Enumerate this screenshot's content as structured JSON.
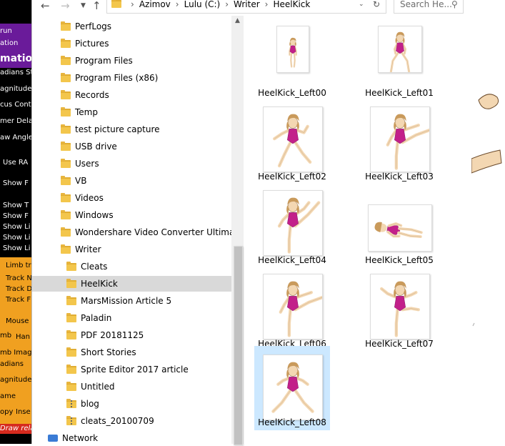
{
  "background_app": {
    "labels": [
      "run",
      "ation",
      "mation",
      "adians Ste",
      "agnitude",
      "cus Cont",
      "mer Delay",
      "aw Angle",
      "Use RA",
      "Show F",
      "Show T",
      "Show F",
      "Show Li",
      "Show Li",
      "Show Li",
      "Limb tra",
      "Track N",
      "Track D",
      "Track F",
      "Mouse",
      "mb",
      "Han",
      "mb Image",
      "adians",
      "agnitude",
      "ame",
      "opy",
      "Inse",
      "Draw relat"
    ]
  },
  "address_bar": {
    "back_icon": "arrow-left-icon",
    "forward_icon": "arrow-right-icon",
    "recent_icon": "chevron-down-icon",
    "up_icon": "arrow-up-icon",
    "breadcrumbs": [
      "Azimov",
      "Lulu (C:)",
      "Writer",
      "HeelKick"
    ],
    "search_placeholder": "Search He..."
  },
  "nav_pane": {
    "items": [
      {
        "label": "PerfLogs",
        "indent": 1,
        "icon": "folder-icon"
      },
      {
        "label": "Pictures",
        "indent": 1,
        "icon": "folder-icon"
      },
      {
        "label": "Program Files",
        "indent": 1,
        "icon": "folder-icon"
      },
      {
        "label": "Program Files (x86)",
        "indent": 1,
        "icon": "folder-icon"
      },
      {
        "label": "Records",
        "indent": 1,
        "icon": "folder-icon"
      },
      {
        "label": "Temp",
        "indent": 1,
        "icon": "folder-icon"
      },
      {
        "label": "test picture capture",
        "indent": 1,
        "icon": "folder-icon"
      },
      {
        "label": "USB drive",
        "indent": 1,
        "icon": "folder-icon"
      },
      {
        "label": "Users",
        "indent": 1,
        "icon": "folder-icon"
      },
      {
        "label": "VB",
        "indent": 1,
        "icon": "folder-icon"
      },
      {
        "label": "Videos",
        "indent": 1,
        "icon": "folder-icon"
      },
      {
        "label": "Windows",
        "indent": 1,
        "icon": "folder-icon"
      },
      {
        "label": "Wondershare Video Converter Ultimate",
        "indent": 1,
        "icon": "folder-icon"
      },
      {
        "label": "Writer",
        "indent": 1,
        "icon": "folder-icon"
      },
      {
        "label": "Cleats",
        "indent": 2,
        "icon": "folder-icon"
      },
      {
        "label": "HeelKick",
        "indent": 2,
        "icon": "folder-icon",
        "selected": true
      },
      {
        "label": "MarsMission Article 5",
        "indent": 2,
        "icon": "folder-icon"
      },
      {
        "label": "Paladin",
        "indent": 2,
        "icon": "folder-icon"
      },
      {
        "label": "PDF 20181125",
        "indent": 2,
        "icon": "folder-icon"
      },
      {
        "label": "Short Stories",
        "indent": 2,
        "icon": "folder-icon"
      },
      {
        "label": "Sprite Editor 2017 article",
        "indent": 2,
        "icon": "folder-icon"
      },
      {
        "label": "Untitled",
        "indent": 2,
        "icon": "folder-icon"
      },
      {
        "label": "blog",
        "indent": 2,
        "icon": "zip-folder-icon"
      },
      {
        "label": "cleats_20100709",
        "indent": 2,
        "icon": "zip-folder-icon"
      },
      {
        "label": "Network",
        "indent": 0,
        "icon": "network-icon"
      }
    ]
  },
  "content_pane": {
    "files": [
      {
        "name": "HeelKick_Left00",
        "pose": "stand"
      },
      {
        "name": "HeelKick_Left01",
        "pose": "crouch"
      },
      {
        "name": "HeelKick_Left02",
        "pose": "lunge"
      },
      {
        "name": "HeelKick_Left03",
        "pose": "kick"
      },
      {
        "name": "HeelKick_Left04",
        "pose": "high-kick"
      },
      {
        "name": "HeelKick_Left05",
        "pose": "prone"
      },
      {
        "name": "HeelKick_Left06",
        "pose": "kick"
      },
      {
        "name": "HeelKick_Left07",
        "pose": "kick-down"
      },
      {
        "name": "HeelKick_Left08",
        "pose": "split",
        "selected": true
      }
    ]
  },
  "colors": {
    "selection_tile": "#cce8ff",
    "selection_nav": "#d9d9d9",
    "leotard": "#c2208a",
    "hair": "#c99a5b",
    "skin": "#f3d7b2"
  }
}
